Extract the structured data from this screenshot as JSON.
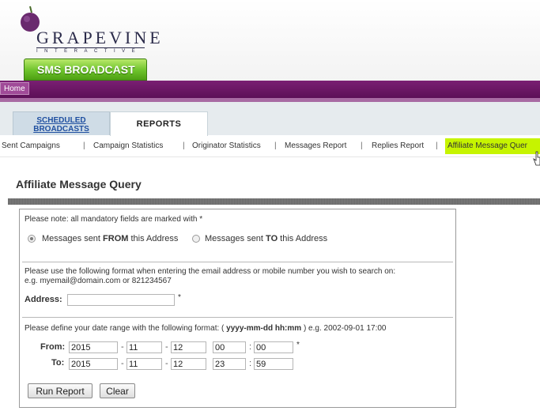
{
  "branding": {
    "logo_name": "GRAPEVINE",
    "logo_tagline": "INTERACTIVE",
    "product_button": "SMS BROADCAST",
    "colors": {
      "nav_purple": "#6b1865",
      "product_green": "#5fb51f",
      "active_subnav": "#c6f400"
    }
  },
  "nav": {
    "home_label": "Home"
  },
  "tabs": {
    "scheduled_line1": "SCHEDULED",
    "scheduled_line2": "BROADCASTS",
    "reports": "REPORTS"
  },
  "subnav": {
    "items": [
      "Sent Campaigns",
      "Campaign Statistics",
      "Originator Statistics",
      "Messages Report",
      "Replies Report",
      "Affiliate Message Quer"
    ],
    "separator": "|"
  },
  "page": {
    "title": "Affiliate Message Query"
  },
  "form": {
    "mandatory_note": "Please note: all mandatory fields are marked with *",
    "radio_from_prefix": "Messages sent ",
    "radio_from_bold": "FROM",
    "radio_from_suffix": " this Address",
    "radio_to_prefix": "Messages sent ",
    "radio_to_bold": "TO",
    "radio_to_suffix": " this Address",
    "radio_selected": "from",
    "format_note_1": "Please use the following format when entering the email address or mobile number you wish to search on:",
    "format_note_2": "e.g. myemail@domain.com or 821234567",
    "address_label": "Address:",
    "address_value": "",
    "required_mark": "*",
    "date_note_prefix": "Please define your date range with the following format: ( ",
    "date_note_format": "yyyy-mm-dd hh:mm",
    "date_note_suffix": " ) e.g. 2002-09-01 17:00",
    "from_label": "From:",
    "to_label": "To:",
    "from": {
      "year": "2015",
      "month": "11",
      "day": "12",
      "hour": "00",
      "minute": "00"
    },
    "to": {
      "year": "2015",
      "month": "11",
      "day": "12",
      "hour": "23",
      "minute": "59"
    },
    "date_sep": "-",
    "time_sep": ":",
    "run_button": "Run Report",
    "clear_button": "Clear"
  }
}
